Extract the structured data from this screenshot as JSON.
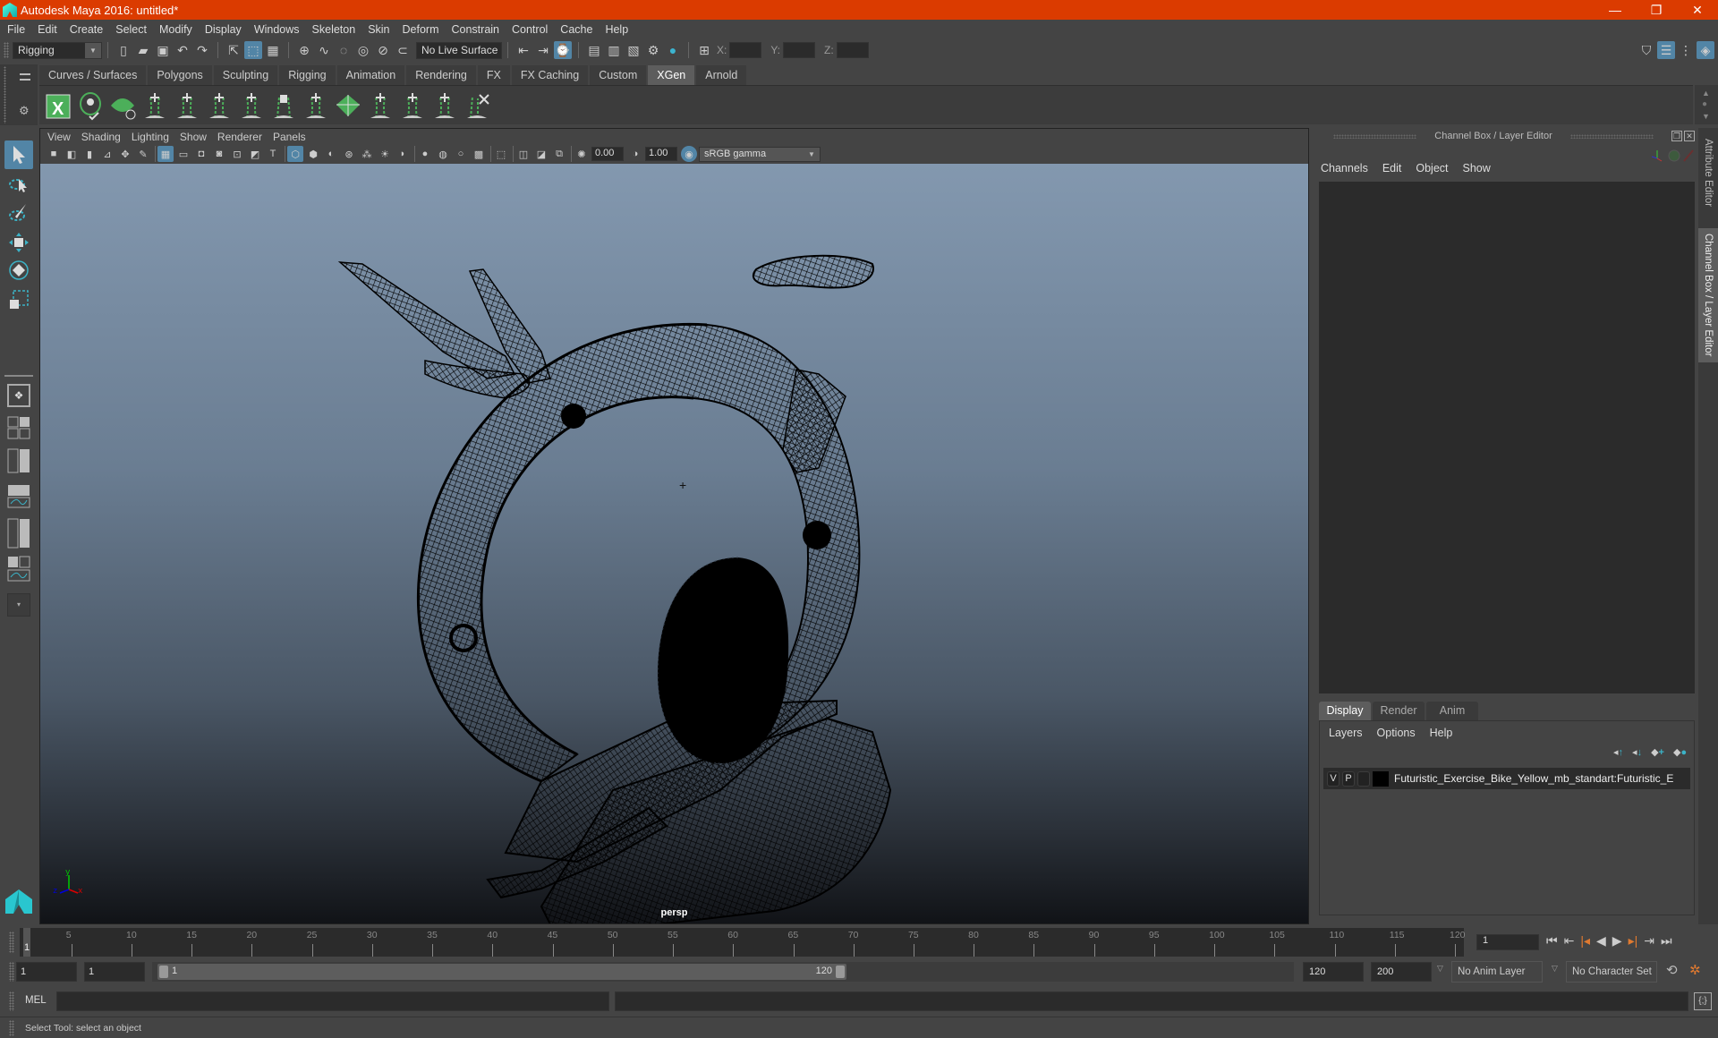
{
  "window": {
    "title": "Autodesk Maya 2016: untitled*",
    "controls": {
      "minimize": "—",
      "restore": "❐",
      "close": "✕"
    }
  },
  "menubar": [
    "File",
    "Edit",
    "Create",
    "Select",
    "Modify",
    "Display",
    "Windows",
    "Skeleton",
    "Skin",
    "Deform",
    "Constrain",
    "Control",
    "Cache",
    "Help"
  ],
  "statusline": {
    "menuset": "Rigging",
    "live_surface": "No Live Surface",
    "x_label": "X:",
    "y_label": "Y:",
    "z_label": "Z:",
    "x_value": "",
    "y_value": "",
    "z_value": ""
  },
  "shelf": {
    "tabs": [
      "Curves / Surfaces",
      "Polygons",
      "Sculpting",
      "Rigging",
      "Animation",
      "Rendering",
      "FX",
      "FX Caching",
      "Custom",
      "XGen",
      "Arnold"
    ],
    "active_tab": "XGen",
    "icons": [
      "xgen-editor-icon",
      "create-description-icon",
      "create-collection-icon",
      "add-guides-icon",
      "place-guides-icon",
      "add-guide-icon",
      "sculpt-guides-icon",
      "lock-guides-icon",
      "rebuild-guides-icon",
      "modifiers-icon",
      "guide-length-icon",
      "select-guides-icon",
      "normalize-guides-icon",
      "delete-guides-icon"
    ]
  },
  "toolbox": {
    "tools": [
      "select-tool",
      "lasso-tool",
      "paint-select-tool",
      "move-tool",
      "rotate-tool",
      "scale-tool"
    ],
    "active_tool": "select-tool"
  },
  "viewport": {
    "menu": [
      "View",
      "Shading",
      "Lighting",
      "Show",
      "Renderer",
      "Panels"
    ],
    "exposure": "0.00",
    "gamma": "1.00",
    "color_space": "sRGB gamma",
    "camera_label": "persp",
    "axis": {
      "x": "x",
      "y": "y",
      "z": "z"
    }
  },
  "channel_box": {
    "header": "Channel Box / Layer Editor",
    "menu": [
      "Channels",
      "Edit",
      "Object",
      "Show"
    ]
  },
  "layer_editor": {
    "tabs": [
      "Display",
      "Render",
      "Anim"
    ],
    "active_tab": "Display",
    "menu": [
      "Layers",
      "Options",
      "Help"
    ],
    "layers": [
      {
        "visible": "V",
        "playback": "P",
        "color": "#000000",
        "name": "Futuristic_Exercise_Bike_Yellow_mb_standart:Futuristic_E"
      }
    ]
  },
  "side_tabs": [
    "Attribute Editor",
    "Channel Box / Layer Editor"
  ],
  "timeline": {
    "start": 1,
    "end": 120,
    "current_frame": "1",
    "ticks": [
      5,
      10,
      15,
      20,
      25,
      30,
      35,
      40,
      45,
      50,
      55,
      60,
      65,
      70,
      75,
      80,
      85,
      90,
      95,
      100,
      105,
      110,
      115,
      120
    ],
    "current_marker": "1"
  },
  "range": {
    "start_time": "1",
    "playback_start": "1",
    "range_start": "1",
    "range_end": "120",
    "playback_end": "120",
    "end_time": "200",
    "anim_layer": "No Anim Layer",
    "character_set": "No Character Set"
  },
  "command_line": {
    "label": "MEL",
    "value": "",
    "result": ""
  },
  "help_line": "Select Tool: select an object",
  "colors": {
    "title_bar": "#db3b00",
    "accent": "#5285a6",
    "xgen_green": "#4caf5a",
    "playback_orange": "#e07a30"
  }
}
